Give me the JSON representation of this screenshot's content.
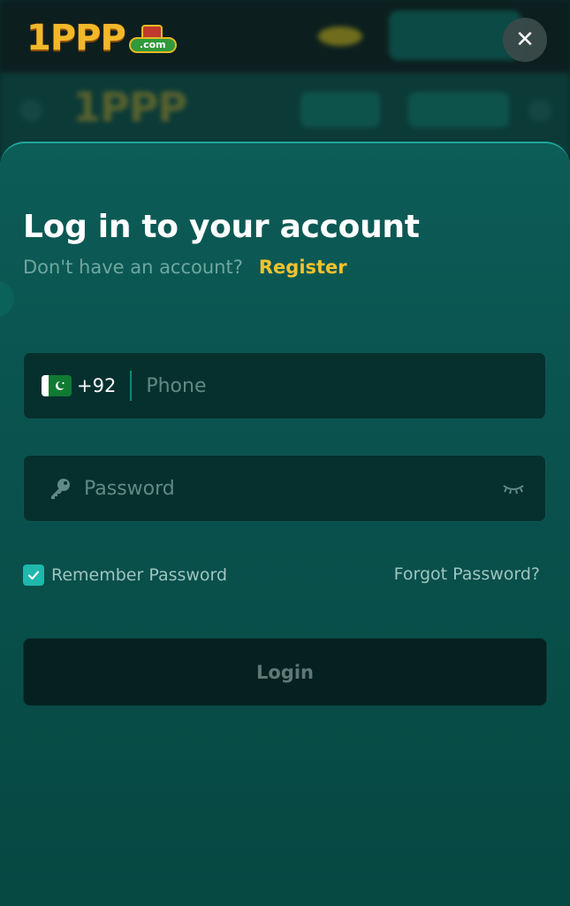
{
  "brand": {
    "logo_text": "1PPP",
    "logo_suffix": ".com"
  },
  "modal": {
    "title": "Log in to your account",
    "subtitle": "Don't have an account?",
    "register_label": "Register"
  },
  "phone": {
    "country_code": "+92",
    "placeholder": "Phone",
    "flag": "pakistan-flag-icon"
  },
  "password": {
    "placeholder": "Password"
  },
  "options": {
    "remember_label": "Remember Password",
    "remember_checked": true,
    "forgot_label": "Forgot Password?"
  },
  "actions": {
    "login_label": "Login",
    "close_symbol": "✕"
  },
  "colors": {
    "accent": "#f5c22e",
    "sheet": "#0a524e",
    "checkbox": "#1eb8ac"
  }
}
